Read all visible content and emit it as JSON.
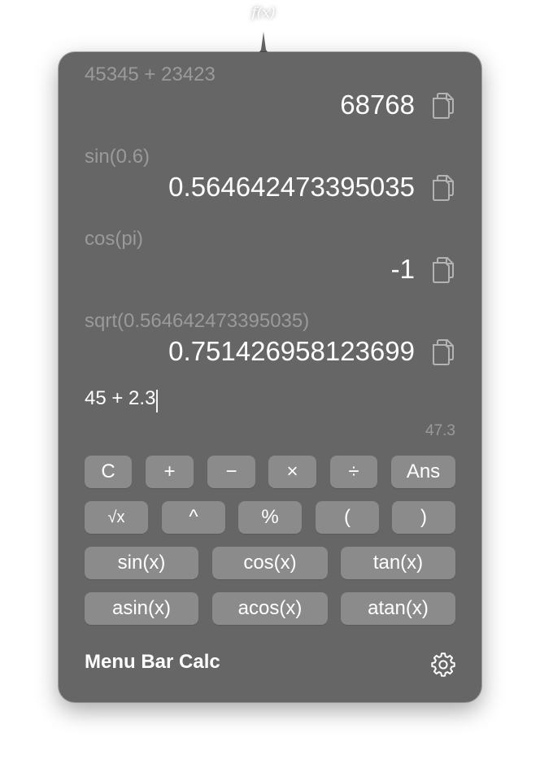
{
  "menubar": {
    "icon_label": "f(x)"
  },
  "history": [
    {
      "expression": "45345 + 23423",
      "result": "68768"
    },
    {
      "expression": "sin(0.6)",
      "result": "0.564642473395035"
    },
    {
      "expression": "cos(pi)",
      "result": "-1"
    },
    {
      "expression": "sqrt(0.564642473395035)",
      "result": "0.751426958123699"
    }
  ],
  "input": {
    "value": "45 + 2.3",
    "preview": "47.3"
  },
  "keypad": {
    "row1": [
      "C",
      "+",
      "−",
      "×",
      "÷",
      "Ans"
    ],
    "row2": [
      "√x",
      "^",
      "%",
      "(",
      ")"
    ],
    "row3": [
      "sin(x)",
      "cos(x)",
      "tan(x)"
    ],
    "row4": [
      "asin(x)",
      "acos(x)",
      "atan(x)"
    ]
  },
  "footer": {
    "title": "Menu Bar Calc",
    "settings_icon": "gear-icon"
  },
  "colors": {
    "popover_bg": "#666666",
    "key_bg": "#8b8b8b",
    "muted_text": "#9a9a9a",
    "text": "#ffffff"
  }
}
